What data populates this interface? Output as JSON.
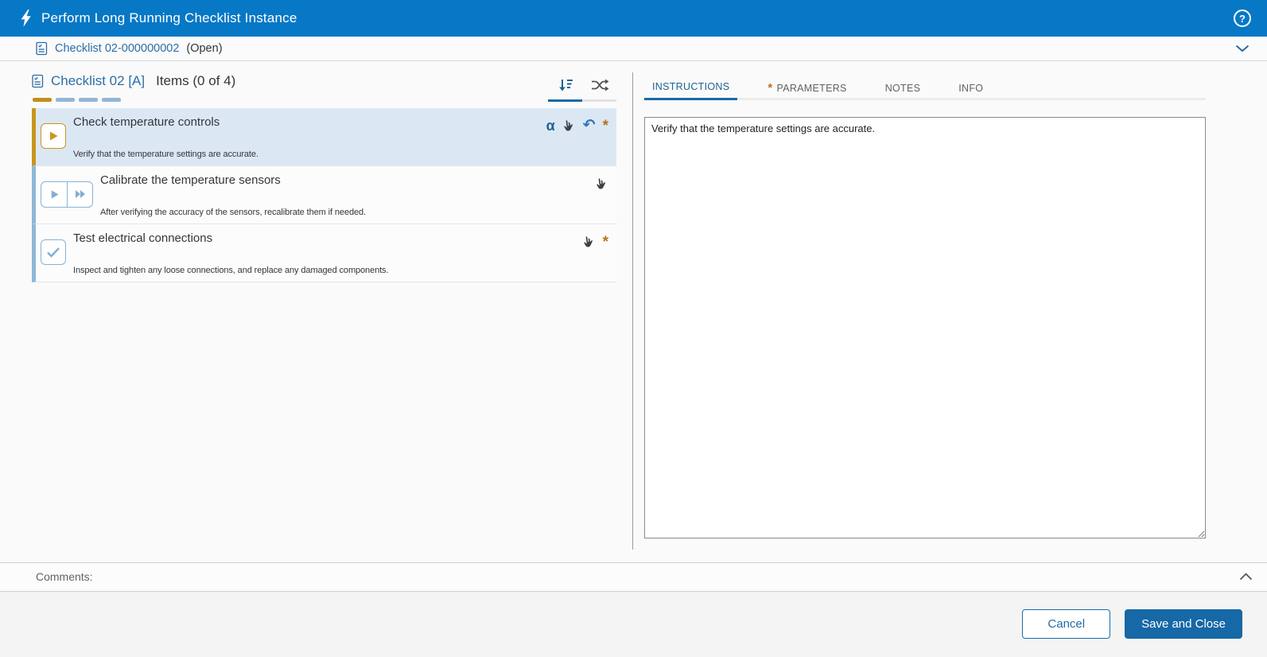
{
  "header": {
    "title": "Perform Long Running Checklist Instance"
  },
  "breadcrumb": {
    "checklist_link": "Checklist 02-000000002",
    "status": "(Open)"
  },
  "glyphs": {
    "alpha": "α",
    "required": "*",
    "help": "?"
  },
  "list_panel": {
    "checklist_link": "Checklist 02 [A]",
    "items_summary": "Items (0 of 4)",
    "progress_segment_colors": [
      "#c28e1d",
      "#92b7d4",
      "#92b7d4",
      "#92b7d4"
    ],
    "items": [
      {
        "title": "Check temperature controls",
        "description": "Verify that the temperature settings are accurate.",
        "state": "selected",
        "icons": [
          "alpha-input",
          "manual-hand",
          "undo",
          "required"
        ]
      },
      {
        "title": "Calibrate the temperature sensors",
        "description": "After verifying the accuracy of the sensors, recalibrate them if needed.",
        "state": "open",
        "icons": [
          "manual-hand"
        ]
      },
      {
        "title": "Test electrical connections",
        "description": "Inspect and tighten any loose connections, and replace any damaged components.",
        "state": "open",
        "icons": [
          "manual-hand",
          "required"
        ]
      }
    ]
  },
  "detail_panel": {
    "tabs": [
      {
        "label": "INSTRUCTIONS",
        "selected": true,
        "required": false
      },
      {
        "label": "PARAMETERS",
        "selected": false,
        "required": true
      },
      {
        "label": "NOTES",
        "selected": false,
        "required": false
      },
      {
        "label": "INFO",
        "selected": false,
        "required": false
      }
    ],
    "instructions_text": "Verify that the temperature settings are accurate."
  },
  "comments": {
    "label": "Comments:"
  },
  "footer": {
    "cancel_label": "Cancel",
    "save_label": "Save and Close"
  },
  "colors": {
    "header_blue": "#0778c6",
    "link_blue": "#2d6da5",
    "selected_tab_blue": "#1c6391",
    "selected_item_bg": "#dbe8f4",
    "gold_accent": "#c8961e",
    "light_blue_accent": "#8fb7d7",
    "required_orange": "#b8721a",
    "save_button_blue": "#1668a6"
  }
}
